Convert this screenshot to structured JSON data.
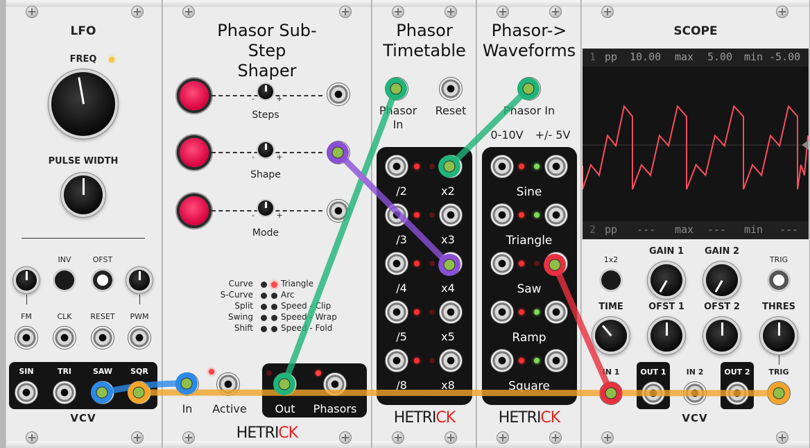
{
  "lfo": {
    "title": "LFO",
    "freq_label": "FREQ",
    "pw_label": "PULSE WIDTH",
    "inv_label": "INV",
    "ofst_label": "OFST",
    "fm_label": "FM",
    "clk_label": "CLK",
    "reset_label": "RESET",
    "pwm_label": "PWM",
    "sin_label": "SIN",
    "tri_label": "TRI",
    "saw_label": "SAW",
    "sqr_label": "SQR",
    "brand": "VCV"
  },
  "shaper": {
    "title": "Phasor Sub-Step\nShaper",
    "steps_label": "Steps",
    "shape_label": "Shape",
    "mode_label": "Mode",
    "minus": "-",
    "plus": "+",
    "modes_left": [
      "Curve",
      "S-Curve",
      "Split",
      "Swing",
      "Shift"
    ],
    "modes_right": [
      "Triangle",
      "Arc",
      "Speed - Clip",
      "Speed - Wrap",
      "Speed - Fold"
    ],
    "in_label": "In",
    "active_label": "Active",
    "out_label": "Out",
    "phasors_label": "Phasors",
    "brand_a": "HETRI",
    "brand_b": "CK"
  },
  "timetable": {
    "title": "Phasor\nTimetable",
    "phasor_in_label": "Phasor\nIn",
    "reset_label": "Reset",
    "rows": [
      {
        "left": "/2",
        "right": "x2"
      },
      {
        "left": "/3",
        "right": "x3"
      },
      {
        "left": "/4",
        "right": "x4"
      },
      {
        "left": "/5",
        "right": "x5"
      },
      {
        "left": "/8",
        "right": "x8"
      }
    ],
    "brand_a": "HETRI",
    "brand_b": "CK"
  },
  "waveforms": {
    "title": "Phasor->\nWaveforms",
    "phasor_in_label": "Phasor In",
    "range_uni": "0-10V",
    "range_bi": "+/- 5V",
    "rows": [
      "Sine",
      "Triangle",
      "Saw",
      "Ramp",
      "Square"
    ],
    "brand_a": "HETRI",
    "brand_b": "CK"
  },
  "scope": {
    "title": "SCOPE",
    "ch1": {
      "num": "1",
      "pp_label": "pp",
      "pp": "10.00",
      "max_label": "max",
      "max": "5.00",
      "min_label": "min",
      "min": "-5.00"
    },
    "ch2": {
      "num": "2",
      "pp_label": "pp",
      "pp": "---",
      "max_label": "max",
      "max": "---",
      "min_label": "min",
      "min": "---"
    },
    "x2_label": "1x2",
    "gain1_label": "GAIN 1",
    "gain2_label": "GAIN 2",
    "trig_btn_label": "TRIG",
    "time_label": "TIME",
    "ofst1_label": "OFST 1",
    "ofst2_label": "OFST 2",
    "thres_label": "THRES",
    "in1_label": "IN 1",
    "out1_label": "OUT 1",
    "in2_label": "IN 2",
    "out2_label": "OUT 2",
    "trig_label": "TRIG",
    "brand": "VCV",
    "trace_color": "#ff4d5e"
  },
  "colors": {
    "cable_orange": "#f2a52a",
    "cable_green": "#1fb57a",
    "cable_purple": "#8a4fd6",
    "cable_red": "#e8303f",
    "cable_blue": "#2b8ae8",
    "brand_red": "#e4211d"
  }
}
